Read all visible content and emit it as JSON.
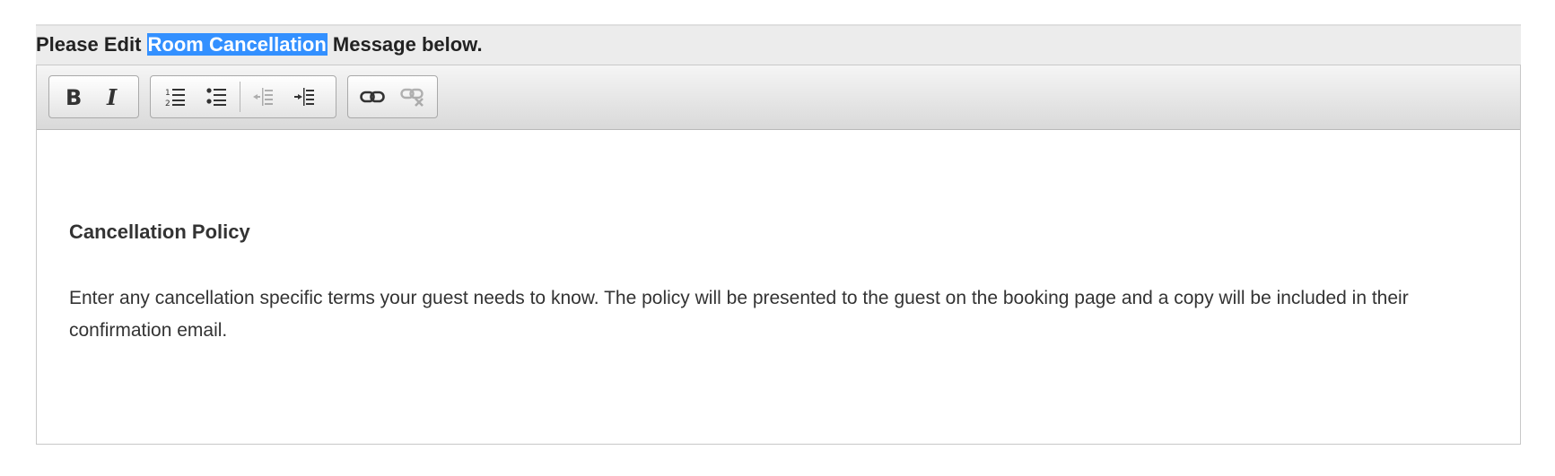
{
  "heading": {
    "prefix": "Please Edit",
    "highlight": "Room Cancellation",
    "suffix": "Message below."
  },
  "toolbar": {
    "buttons": [
      {
        "name": "bold",
        "icon": "bold-icon"
      },
      {
        "name": "italic",
        "icon": "italic-icon"
      },
      {
        "name": "numbered-list",
        "icon": "numbered-list-icon"
      },
      {
        "name": "bulleted-list",
        "icon": "bulleted-list-icon"
      },
      {
        "name": "decrease-indent",
        "icon": "outdent-icon",
        "disabled": true
      },
      {
        "name": "increase-indent",
        "icon": "indent-icon"
      },
      {
        "name": "link",
        "icon": "link-icon"
      },
      {
        "name": "unlink",
        "icon": "unlink-icon",
        "disabled": true
      }
    ]
  },
  "editor": {
    "title": "Cancellation Policy",
    "body": "Enter any cancellation specific terms your guest needs to know. The policy will be presented to the guest on the booking page and a copy will be included in their confirmation email."
  },
  "colors": {
    "selection_highlight": "#3390ff",
    "heading_bar": "#ececec",
    "text": "#333333"
  }
}
